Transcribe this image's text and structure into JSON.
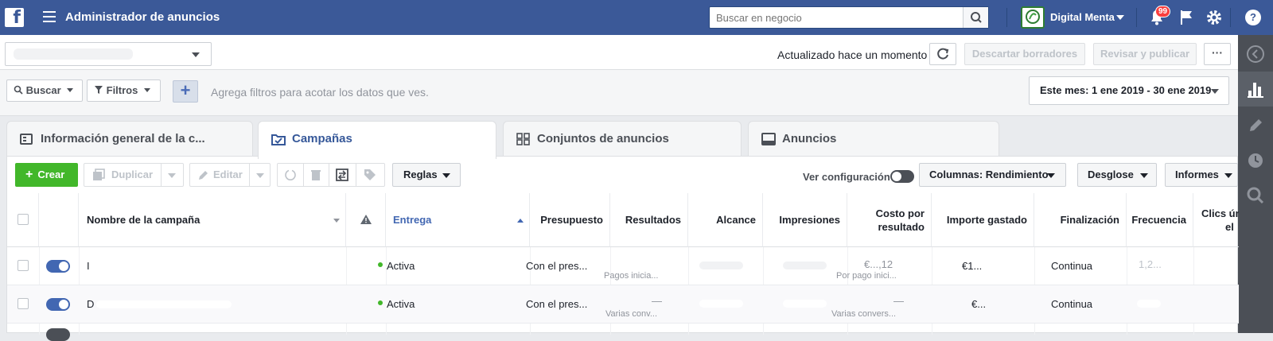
{
  "topbar": {
    "app_title": "Administrador de anuncios",
    "search_placeholder": "Buscar en negocio",
    "account_name": "Digital Menta",
    "notification_count": "99",
    "colors": {
      "bar": "#3b5998",
      "badge": "#fa3e3e"
    }
  },
  "toolbar": {
    "updated_text": "Actualizado hace un momento",
    "discard_label": "Descartar borradores",
    "review_label": "Revisar y publicar",
    "more_label": "···"
  },
  "filters": {
    "search_label": "Buscar",
    "filters_label": "Filtros",
    "add_label": "+",
    "hint": "Agrega filtros para acotar los datos que ves.",
    "date_range": "Este mes: 1 ene 2019 - 30 ene 2019"
  },
  "tabs": [
    {
      "label": "Información general de la c...",
      "icon": "overview-icon"
    },
    {
      "label": "Campañas",
      "icon": "folder-check-icon",
      "active": true
    },
    {
      "label": "Conjuntos de anuncios",
      "icon": "grid-icon"
    },
    {
      "label": "Anuncios",
      "icon": "ad-icon"
    }
  ],
  "actions": {
    "create_label": "Crear",
    "duplicate_label": "Duplicar",
    "edit_label": "Editar",
    "rules_label": "Reglas",
    "view_config_label": "Ver configuración",
    "columns_label": "Columnas: Rendimiento",
    "breakdown_label": "Desglose",
    "reports_label": "Informes",
    "create_color": "#42b72a"
  },
  "table": {
    "headers": {
      "name": "Nombre de la campaña",
      "delivery": "Entrega",
      "budget": "Presupuesto",
      "results": "Resultados",
      "reach": "Alcance",
      "impressions": "Impresiones",
      "cost_line1": "Costo por",
      "cost_line2": "resultado",
      "spent": "Importe gastado",
      "end": "Finalización",
      "frequency": "Frecuencia",
      "clicks_line1": "Clics úni",
      "clicks_line2": "el"
    },
    "rows": [
      {
        "name": "I",
        "delivery": "Activa",
        "budget": "Con el pres...",
        "results_sub": "Pagos inicia...",
        "cost": "€...,12",
        "cost_sub": "Por pago inici...",
        "spent": "€1...",
        "end": "Continua",
        "frequency": "1,2..."
      },
      {
        "name": "D",
        "delivery": "Activa",
        "budget": "Con el pres...",
        "results": "—",
        "results_sub": "Varias conv...",
        "cost": "—",
        "cost_sub": "Varias convers...",
        "spent": "€...",
        "end": "Continua",
        "frequency": ""
      }
    ]
  }
}
